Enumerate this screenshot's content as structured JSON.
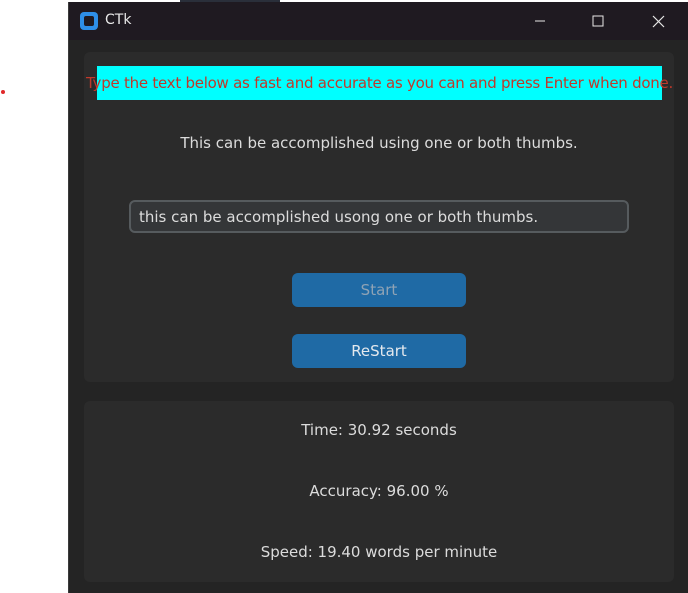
{
  "window": {
    "title": "CTk",
    "controls": {
      "minimize_icon": "minimize-icon",
      "maximize_icon": "maximize-icon",
      "close_icon": "close-icon"
    }
  },
  "typing_test": {
    "instruction": "Type the text below as fast and accurate as you can and press Enter when done.",
    "target_sentence": "This can be accomplished using one or both thumbs.",
    "input_value": "this can be accomplished usong one or both thumbs.",
    "start_label": "Start",
    "restart_label": "ReStart"
  },
  "results": {
    "time": "Time: 30.92 seconds",
    "accuracy": "Accuracy: 96.00 %",
    "speed": "Speed: 19.40 words per minute"
  },
  "colors": {
    "banner_bg": "#00ffff",
    "banner_text": "#c0392b",
    "button": "#1f6aa5",
    "window_bg": "#242424",
    "panel_bg": "#2b2b2b"
  }
}
